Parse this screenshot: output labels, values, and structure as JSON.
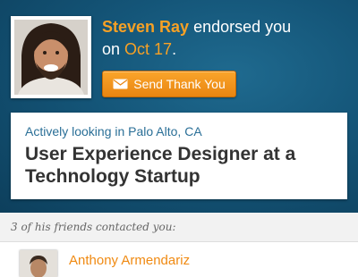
{
  "endorsement": {
    "name": "Steven Ray",
    "action": " endorsed you",
    "date_prefix": "on ",
    "date": "Oct 17",
    "date_suffix": "."
  },
  "thanks_button": {
    "label": "Send Thank You",
    "icon": "envelope-icon"
  },
  "job": {
    "status_prefix": "Actively looking in ",
    "location": "Palo Alto, CA",
    "title": "User Experience Designer at a Technology Startup"
  },
  "friends": {
    "header": "3 of his friends contacted you:",
    "items": [
      {
        "name": "Anthony Armendariz"
      }
    ]
  },
  "colors": {
    "hero_bg": "#145578",
    "accent_orange": "#f7a125",
    "link_blue": "#2a6f97",
    "title_text": "#333333"
  }
}
